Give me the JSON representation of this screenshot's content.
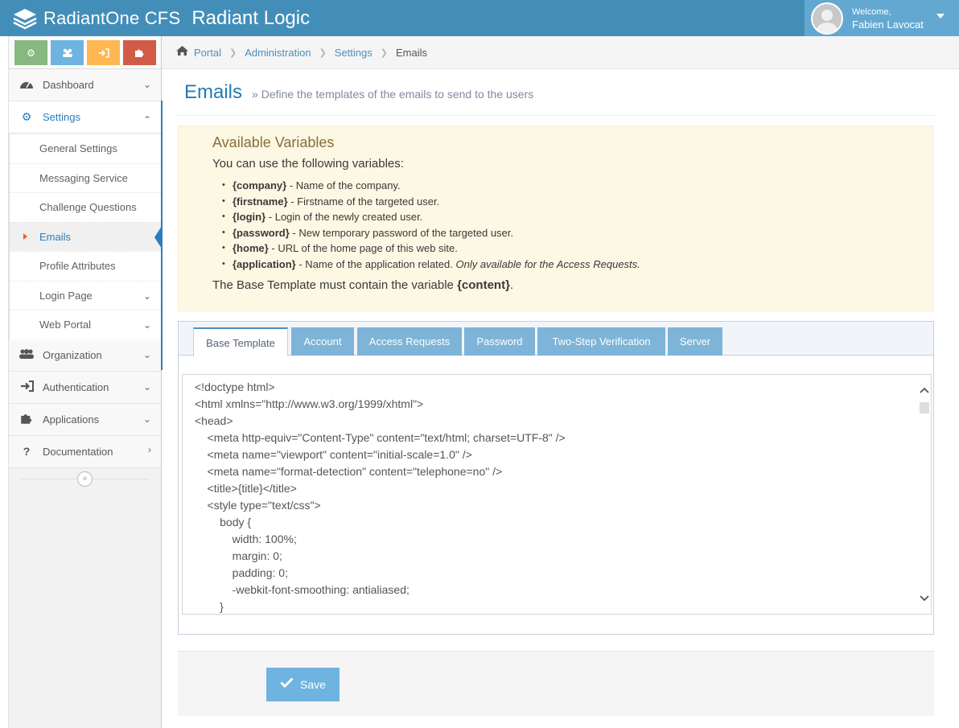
{
  "brand": {
    "product": "RadiantOne CFS",
    "company": "Radiant Logic",
    "logo_icon": "layers-icon"
  },
  "user": {
    "welcome": "Welcome,",
    "name": "Fabien Lavocat"
  },
  "shortcuts": [
    {
      "icon": "cogs-icon",
      "color": "#87b87f"
    },
    {
      "icon": "users-icon",
      "color": "#6fb3e0"
    },
    {
      "icon": "sign-in-icon",
      "color": "#ffb752"
    },
    {
      "icon": "puzzle-icon",
      "color": "#d15b47"
    }
  ],
  "sidebar": {
    "dashboard": "Dashboard",
    "settings": "Settings",
    "settings_items": [
      "General Settings",
      "Messaging Service",
      "Challenge Questions",
      "Emails",
      "Profile Attributes",
      "Login Page",
      "Web Portal"
    ],
    "organization": "Organization",
    "authentication": "Authentication",
    "applications": "Applications",
    "documentation": "Documentation"
  },
  "breadcrumb": {
    "items": [
      "Portal",
      "Administration",
      "Settings"
    ],
    "current": "Emails"
  },
  "page": {
    "title": "Emails",
    "subtitle": "Define the templates of the emails to send to the users"
  },
  "variables": {
    "title": "Available Variables",
    "intro": "You can use the following variables:",
    "items": [
      {
        "name": "{company}",
        "desc": " - Name of the company.",
        "note": ""
      },
      {
        "name": "{firstname}",
        "desc": " - Firstname of the targeted user.",
        "note": ""
      },
      {
        "name": "{login}",
        "desc": " - Login of the newly created user.",
        "note": ""
      },
      {
        "name": "{password}",
        "desc": " - New temporary password of the targeted user.",
        "note": ""
      },
      {
        "name": "{home}",
        "desc": " - URL of the home page of this web site.",
        "note": ""
      },
      {
        "name": "{application}",
        "desc": " - Name of the application related. ",
        "note": "Only available for the Access Requests."
      }
    ],
    "footer_prefix": "The Base Template must contain the variable ",
    "footer_var": "{content}",
    "footer_suffix": "."
  },
  "tabs": [
    "Base Template",
    "Account",
    "Access Requests",
    "Password",
    "Two-Step Verification",
    "Server"
  ],
  "active_tab": "Base Template",
  "code": [
    "<!doctype html>",
    "<html xmlns=\"http://www.w3.org/1999/xhtml\">",
    "<head>",
    "    <meta http-equiv=\"Content-Type\" content=\"text/html; charset=UTF-8\" />",
    "    <meta name=\"viewport\" content=\"initial-scale=1.0\" />",
    "    <meta name=\"format-detection\" content=\"telephone=no\" />",
    "    <title>{title}</title>",
    "    <style type=\"text/css\">",
    "        body {",
    "            width: 100%;",
    "            margin: 0;",
    "            padding: 0;",
    "            -webkit-font-smoothing: antialiased;",
    "        }"
  ],
  "actions": {
    "save": "Save"
  }
}
